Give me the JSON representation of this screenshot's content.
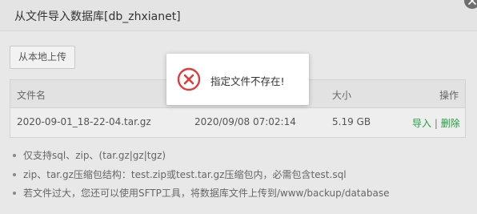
{
  "dialog": {
    "title": "从文件导入数据库[db_zhxianet]",
    "upload_label": "从本地上传"
  },
  "table": {
    "headers": {
      "filename": "文件名",
      "size": "大小",
      "actions": "操作"
    },
    "rows": [
      {
        "filename": "2020-09-01_18-22-04.tar.gz",
        "modified": "2020/09/08 07:02:14",
        "size": "5.19 GB",
        "import_label": "导入",
        "separator": "|",
        "delete_label": "删除"
      }
    ]
  },
  "tips": [
    "仅支持sql、zip、(tar.gz|gz|tgz)",
    "zip、tar.gz压缩包结构：test.zip或test.tar.gz压缩包内，必需包含test.sql",
    "若文件过大，您还可以使用SFTP工具，将数据库文件上传到/www/backup/database"
  ],
  "toast": {
    "message": "指定文件不存在!",
    "icon": "error-circle-icon",
    "icon_color": "#e03a3a"
  },
  "colors": {
    "link_green": "#1e9e3e",
    "error_red": "#e03a3a"
  }
}
